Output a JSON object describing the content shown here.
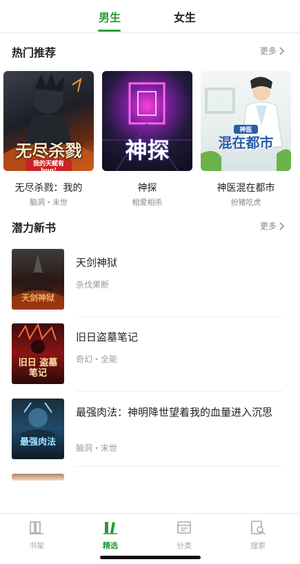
{
  "tabs": {
    "male": "男生",
    "female": "女生"
  },
  "hot": {
    "title": "热门推荐",
    "more": "更多",
    "books": [
      {
        "title": "无尽杀戮：我的",
        "sub": "脑洞・末世",
        "cover_text": "无尽杀戮",
        "cover_subtext": "我的天赋有bug!"
      },
      {
        "title": "神探",
        "sub": "相爱相杀",
        "cover_text": "神探",
        "cover_subtext": ""
      },
      {
        "title": "神医混在都市",
        "sub": "扮猪吃虎",
        "cover_text": "混在都市",
        "cover_subtext": "神医"
      }
    ]
  },
  "potential": {
    "title": "潜力新书",
    "more": "更多",
    "books": [
      {
        "title": "天剑神狱",
        "meta": "杀伐果断",
        "cover_text": "天剑神狱"
      },
      {
        "title": "旧日盗墓笔记",
        "meta": "奇幻・全能",
        "cover_text": "旧日 盗墓笔记"
      },
      {
        "title": "最强肉法：神明降世望着我的血量进入沉思",
        "meta": "脑洞・末世",
        "cover_text": "最强肉法"
      }
    ]
  },
  "nav": {
    "items": [
      {
        "label": "书架",
        "icon": "bookshelf-icon"
      },
      {
        "label": "精选",
        "icon": "featured-icon"
      },
      {
        "label": "分类",
        "icon": "category-icon"
      },
      {
        "label": "搜索",
        "icon": "search-icon"
      }
    ]
  },
  "colors": {
    "accent": "#2a9a3a",
    "muted": "#999999"
  }
}
